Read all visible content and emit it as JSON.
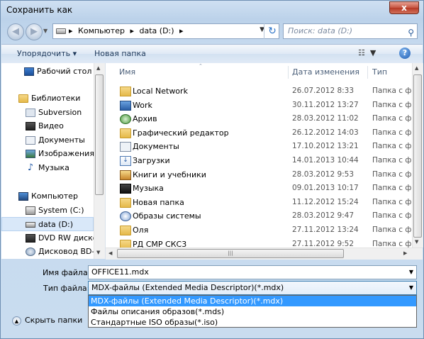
{
  "window": {
    "title": "Сохранить как",
    "close_label": "x"
  },
  "nav": {
    "breadcrumbs": [
      "Компьютер",
      "data (D:)"
    ],
    "search_placeholder": "Поиск: data (D:)"
  },
  "toolbar": {
    "organize_label": "Упорядочить ▾",
    "new_folder_label": "Новая папка"
  },
  "sidebar": {
    "items": [
      {
        "label": "Рабочий стол",
        "icon": "desktop-icon"
      },
      {
        "label": "Библиотеки",
        "icon": "libraries-icon"
      },
      {
        "label": "Subversion",
        "icon": "subversion-icon"
      },
      {
        "label": "Видео",
        "icon": "video-icon"
      },
      {
        "label": "Документы",
        "icon": "documents-icon"
      },
      {
        "label": "Изображения",
        "icon": "images-icon"
      },
      {
        "label": "Музыка",
        "icon": "music-icon"
      },
      {
        "label": "Компьютер",
        "icon": "computer-icon"
      },
      {
        "label": "System (C:)",
        "icon": "drive-icon"
      },
      {
        "label": "data (D:)",
        "icon": "drive-icon"
      },
      {
        "label": "DVD RW дисков",
        "icon": "dvd-icon"
      },
      {
        "label": "Дисковод BD-R",
        "icon": "bd-drive-icon"
      }
    ]
  },
  "files": {
    "columns": {
      "name": "Имя",
      "date": "Дата изменения",
      "type": "Тип"
    },
    "rows": [
      {
        "name": "Local Network",
        "date": "26.07.2012 8:33",
        "type": "Папка с ф",
        "icon": "network-folder-icon"
      },
      {
        "name": "Work",
        "date": "30.11.2012 13:27",
        "type": "Папка с ф",
        "icon": "work-folder-icon"
      },
      {
        "name": "Архив",
        "date": "28.03.2012 11:02",
        "type": "Папка с ф",
        "icon": "archive-folder-icon"
      },
      {
        "name": "Графический редактор",
        "date": "26.12.2012 14:03",
        "type": "Папка с ф",
        "icon": "folder-icon"
      },
      {
        "name": "Документы",
        "date": "17.10.2012 13:21",
        "type": "Папка с ф",
        "icon": "documents-folder-icon"
      },
      {
        "name": "Загрузки",
        "date": "14.01.2013 10:44",
        "type": "Папка с ф",
        "icon": "downloads-folder-icon"
      },
      {
        "name": "Книги и учебники",
        "date": "28.03.2012 9:53",
        "type": "Папка с ф",
        "icon": "books-folder-icon"
      },
      {
        "name": "Музыка",
        "date": "09.01.2013 10:17",
        "type": "Папка с ф",
        "icon": "music-folder-icon"
      },
      {
        "name": "Новая папка",
        "date": "11.12.2012 15:24",
        "type": "Папка с ф",
        "icon": "folder-icon"
      },
      {
        "name": "Образы системы",
        "date": "28.03.2012 9:47",
        "type": "Папка с ф",
        "icon": "disc-images-folder-icon"
      },
      {
        "name": "Оля",
        "date": "27.11.2012 13:24",
        "type": "Папка с ф",
        "icon": "folder-icon"
      },
      {
        "name": "РД СМР СКС3",
        "date": "27.11.2012 9:52",
        "type": "Папка с ф",
        "icon": "folder-icon"
      }
    ]
  },
  "form": {
    "filename_label": "Имя файла:",
    "filename_value": "OFFICE11.mdx",
    "filetype_label": "Тип файла:",
    "filetype_value": "MDX-файлы (Extended Media Descriptor)(*.mdx)",
    "filetype_options": [
      "MDX-файлы (Extended Media Descriptor)(*.mdx)",
      "Файлы описания образов(*.mds)",
      "Стандартные ISO образы(*.iso)"
    ],
    "hide_folders_label": "Скрыть папки"
  }
}
